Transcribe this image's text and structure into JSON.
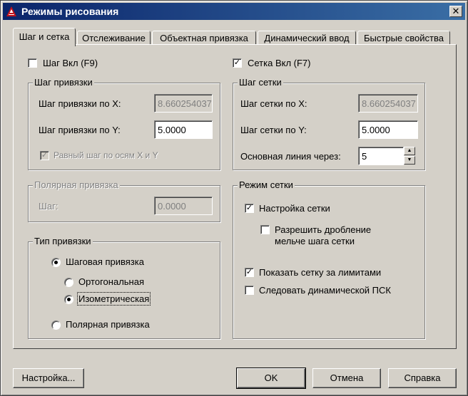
{
  "window": {
    "title": "Режимы рисования",
    "close_label": "✕"
  },
  "tabs": [
    {
      "label": "Шаг и сетка",
      "active": true
    },
    {
      "label": "Отслеживание",
      "active": false
    },
    {
      "label": "Объектная привязка",
      "active": false
    },
    {
      "label": "Динамический ввод",
      "active": false
    },
    {
      "label": "Быстрые свойства",
      "active": false
    }
  ],
  "snap": {
    "enable_label": "Шаг Вкл (F9)",
    "enabled": false,
    "spacing_group": "Шаг привязки",
    "x_label": "Шаг привязки по X:",
    "x_value": "8.660254037",
    "y_label": "Шаг привязки по Y:",
    "y_value": "5.0000",
    "equal_label": "Равный шаг по осям X и Y",
    "equal_checked": true
  },
  "polar": {
    "group": "Полярная привязка",
    "distance_label": "Шаг:",
    "distance_value": "0.0000"
  },
  "snap_type": {
    "group": "Тип привязки",
    "grid_snap": "Шаговая привязка",
    "rectangular": "Ортогональная",
    "isometric": "Изометрическая",
    "polar_snap": "Полярная привязка",
    "selected": "isometric"
  },
  "grid": {
    "enable_label": "Сетка Вкл (F7)",
    "enabled": true,
    "spacing_group": "Шаг сетки",
    "x_label": "Шаг сетки по X:",
    "x_value": "8.660254037",
    "y_label": "Шаг сетки по Y:",
    "y_value": "5.0000",
    "major_label": "Основная линия через:",
    "major_value": "5"
  },
  "grid_behavior": {
    "group": "Режим сетки",
    "adaptive": "Настройка сетки",
    "adaptive_checked": true,
    "subdivision_line1": "Разрешить дробление",
    "subdivision_line2": "мельче шага сетки",
    "subdivision_checked": false,
    "beyond_limits": "Показать сетку за лимитами",
    "beyond_checked": true,
    "follow_ucs": "Следовать динамической ПСК",
    "follow_checked": false
  },
  "buttons": {
    "options": "Настройка...",
    "ok": "OK",
    "cancel": "Отмена",
    "help": "Справка"
  },
  "icons": {
    "app": "autocad-logo-icon",
    "spin_up": "spin-up-arrow-icon",
    "spin_down": "spin-down-arrow-icon"
  }
}
